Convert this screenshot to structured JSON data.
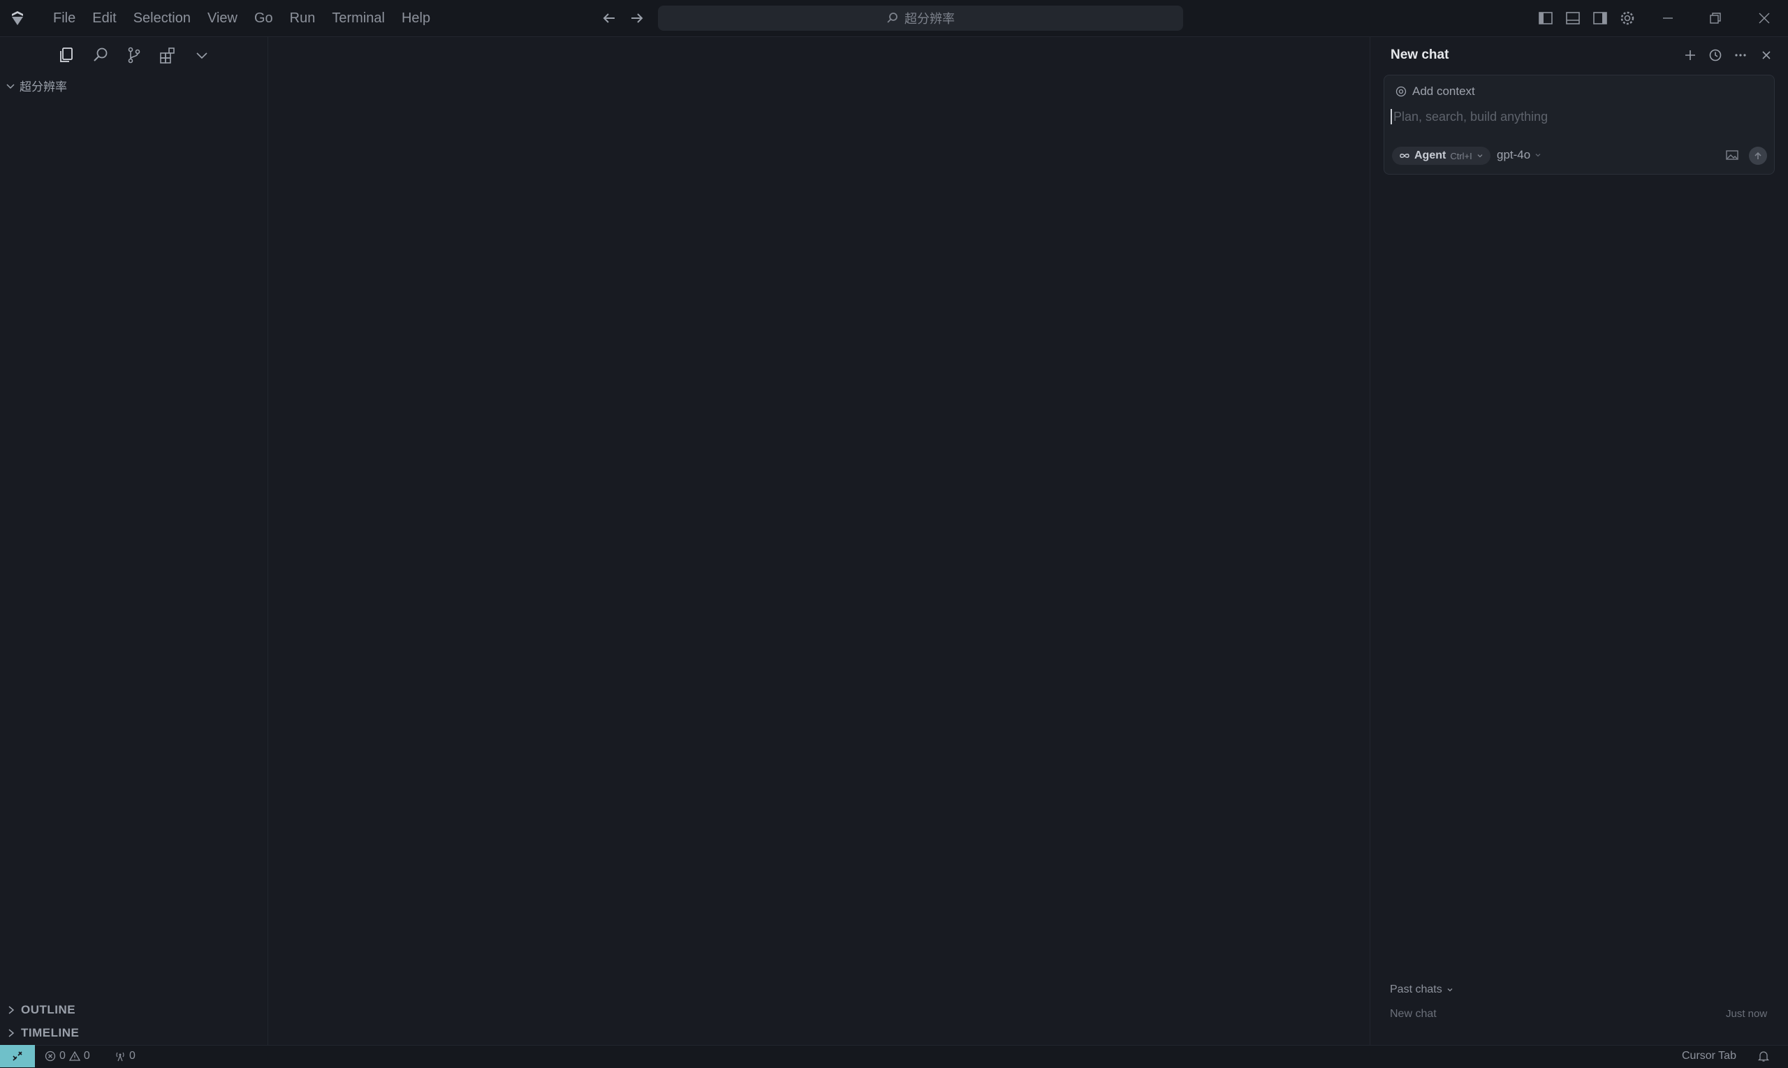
{
  "menu": [
    "File",
    "Edit",
    "Selection",
    "View",
    "Go",
    "Run",
    "Terminal",
    "Help"
  ],
  "search": {
    "label": "超分辨率"
  },
  "explorer": {
    "root": "超分辨率"
  },
  "sections": {
    "outline": "OUTLINE",
    "timeline": "TIMELINE"
  },
  "chat": {
    "title": "New chat",
    "add_context": "Add context",
    "placeholder": "Plan, search, build anything",
    "mode": "Agent",
    "mode_shortcut": "Ctrl+I",
    "model": "gpt-4o",
    "past_chats_label": "Past chats",
    "past": [
      {
        "title": "New chat",
        "time": "Just now"
      }
    ]
  },
  "status": {
    "errors": "0",
    "warnings": "0",
    "ports": "0",
    "cursor_tab": "Cursor Tab"
  },
  "colors": {
    "accent": "#6fc0c9",
    "background": "#181b22",
    "titlebar": "#15181e"
  }
}
